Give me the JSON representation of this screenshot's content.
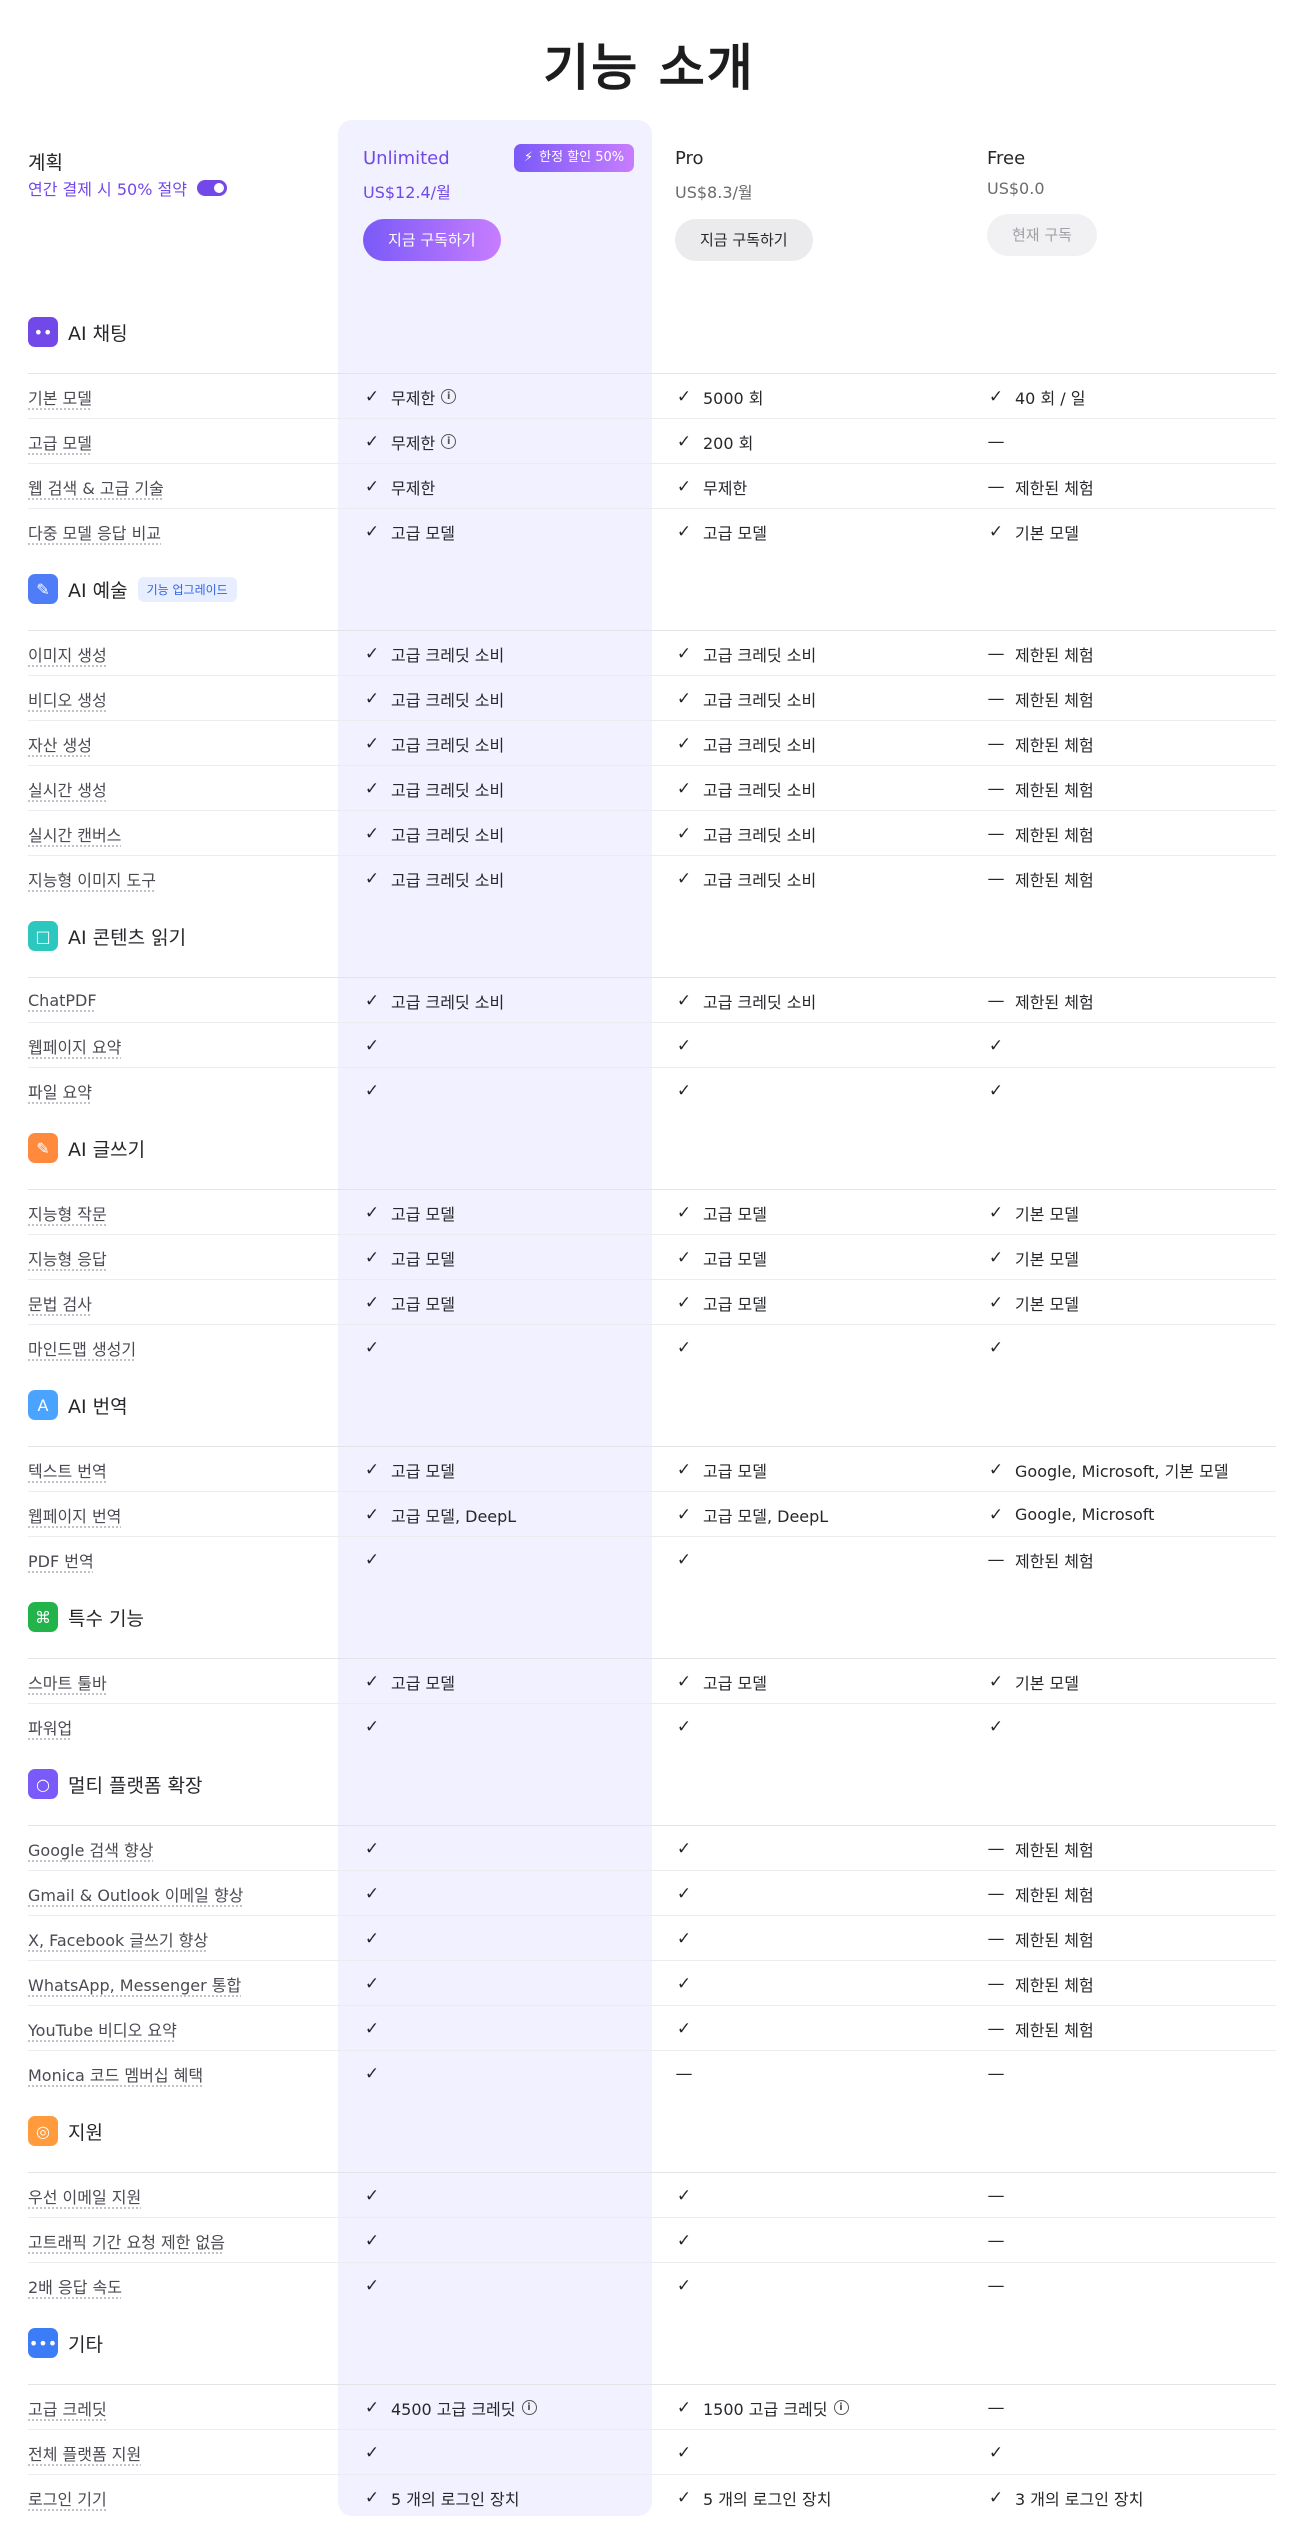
{
  "title": "기능 소개",
  "header": {
    "plan_label": "계획",
    "annual_text": "연간 결제 시 50% 절약",
    "badge": "한정 할인 50%",
    "plans": [
      {
        "name": "Unlimited",
        "price": "US$12.4/월",
        "button": "지금 구독하기"
      },
      {
        "name": "Pro",
        "price": "US$8.3/월",
        "button": "지금 구독하기"
      },
      {
        "name": "Free",
        "price": "US$0.0",
        "button": "현재 구독"
      }
    ]
  },
  "sections": [
    {
      "title": "AI 채팅",
      "icon": "chat-bubble-icon",
      "color": "#7248e8",
      "rows": [
        {
          "label": "기본 모델",
          "cells": [
            [
              "check",
              "무제한",
              true
            ],
            [
              "check",
              "5000 회"
            ],
            [
              "check",
              "40 회 / 일"
            ]
          ]
        },
        {
          "label": "고급 모델",
          "cells": [
            [
              "check",
              "무제한",
              true
            ],
            [
              "check",
              "200 회"
            ],
            [
              "dash",
              ""
            ]
          ]
        },
        {
          "label": "웹 검색 & 고급 기술",
          "cells": [
            [
              "check",
              "무제한"
            ],
            [
              "check",
              "무제한"
            ],
            [
              "dash",
              "제한된 체험"
            ]
          ]
        },
        {
          "label": "다중 모델 응답 비교",
          "cells": [
            [
              "check",
              "고급 모델"
            ],
            [
              "check",
              "고급 모델"
            ],
            [
              "check",
              "기본 모델"
            ]
          ]
        }
      ]
    },
    {
      "title": "AI 예술",
      "tag": "기능 업그레이드",
      "icon": "brush-icon",
      "color": "#4f7cf7",
      "rows": [
        {
          "label": "이미지 생성",
          "cells": [
            [
              "check",
              "고급 크레딧 소비"
            ],
            [
              "check",
              "고급 크레딧 소비"
            ],
            [
              "dash",
              "제한된 체험"
            ]
          ]
        },
        {
          "label": "비디오 생성",
          "cells": [
            [
              "check",
              "고급 크레딧 소비"
            ],
            [
              "check",
              "고급 크레딧 소비"
            ],
            [
              "dash",
              "제한된 체험"
            ]
          ]
        },
        {
          "label": "자산 생성",
          "cells": [
            [
              "check",
              "고급 크레딧 소비"
            ],
            [
              "check",
              "고급 크레딧 소비"
            ],
            [
              "dash",
              "제한된 체험"
            ]
          ]
        },
        {
          "label": "실시간 생성",
          "cells": [
            [
              "check",
              "고급 크레딧 소비"
            ],
            [
              "check",
              "고급 크레딧 소비"
            ],
            [
              "dash",
              "제한된 체험"
            ]
          ]
        },
        {
          "label": "실시간 캔버스",
          "cells": [
            [
              "check",
              "고급 크레딧 소비"
            ],
            [
              "check",
              "고급 크레딧 소비"
            ],
            [
              "dash",
              "제한된 체험"
            ]
          ]
        },
        {
          "label": "지능형 이미지 도구",
          "cells": [
            [
              "check",
              "고급 크레딧 소비"
            ],
            [
              "check",
              "고급 크레딧 소비"
            ],
            [
              "dash",
              "제한된 체험"
            ]
          ]
        }
      ]
    },
    {
      "title": "AI 콘텐츠 읽기",
      "icon": "book-icon",
      "color": "#2cc8c0",
      "rows": [
        {
          "label": "ChatPDF",
          "cells": [
            [
              "check",
              "고급 크레딧 소비"
            ],
            [
              "check",
              "고급 크레딧 소비"
            ],
            [
              "dash",
              "제한된 체험"
            ]
          ]
        },
        {
          "label": "웹페이지 요약",
          "cells": [
            [
              "check",
              ""
            ],
            [
              "check",
              ""
            ],
            [
              "check",
              ""
            ]
          ]
        },
        {
          "label": "파일 요약",
          "cells": [
            [
              "check",
              ""
            ],
            [
              "check",
              ""
            ],
            [
              "check",
              ""
            ]
          ]
        }
      ]
    },
    {
      "title": "AI 글쓰기",
      "icon": "pencil-icon",
      "color": "#ff8a3d",
      "rows": [
        {
          "label": "지능형 작문",
          "cells": [
            [
              "check",
              "고급 모델"
            ],
            [
              "check",
              "고급 모델"
            ],
            [
              "check",
              "기본 모델"
            ]
          ]
        },
        {
          "label": "지능형 응답",
          "cells": [
            [
              "check",
              "고급 모델"
            ],
            [
              "check",
              "고급 모델"
            ],
            [
              "check",
              "기본 모델"
            ]
          ]
        },
        {
          "label": "문법 검사",
          "cells": [
            [
              "check",
              "고급 모델"
            ],
            [
              "check",
              "고급 모델"
            ],
            [
              "check",
              "기본 모델"
            ]
          ]
        },
        {
          "label": "마인드맵 생성기",
          "cells": [
            [
              "check",
              ""
            ],
            [
              "check",
              ""
            ],
            [
              "check",
              ""
            ]
          ]
        }
      ]
    },
    {
      "title": "AI 번역",
      "icon": "translate-icon",
      "color": "#4aa3ff",
      "rows": [
        {
          "label": "텍스트 번역",
          "cells": [
            [
              "check",
              "고급 모델"
            ],
            [
              "check",
              "고급 모델"
            ],
            [
              "check",
              "Google, Microsoft, 기본 모델"
            ]
          ]
        },
        {
          "label": "웹페이지 번역",
          "cells": [
            [
              "check",
              "고급 모델, DeepL"
            ],
            [
              "check",
              "고급 모델, DeepL"
            ],
            [
              "check",
              "Google, Microsoft"
            ]
          ]
        },
        {
          "label": "PDF 번역",
          "cells": [
            [
              "check",
              ""
            ],
            [
              "check",
              ""
            ],
            [
              "dash",
              "제한된 체험"
            ]
          ]
        }
      ]
    },
    {
      "title": "특수 기능",
      "icon": "command-icon",
      "color": "#22b44a",
      "rows": [
        {
          "label": "스마트 툴바",
          "cells": [
            [
              "check",
              "고급 모델"
            ],
            [
              "check",
              "고급 모델"
            ],
            [
              "check",
              "기본 모델"
            ]
          ]
        },
        {
          "label": "파워업",
          "cells": [
            [
              "check",
              ""
            ],
            [
              "check",
              ""
            ],
            [
              "check",
              ""
            ]
          ]
        }
      ]
    },
    {
      "title": "멀티 플랫폼 확장",
      "icon": "planet-icon",
      "color": "#7a5af8",
      "rows": [
        {
          "label": "Google 검색 향상",
          "cells": [
            [
              "check",
              ""
            ],
            [
              "check",
              ""
            ],
            [
              "dash",
              "제한된 체험"
            ]
          ]
        },
        {
          "label": "Gmail & Outlook 이메일 향상",
          "cells": [
            [
              "check",
              ""
            ],
            [
              "check",
              ""
            ],
            [
              "dash",
              "제한된 체험"
            ]
          ]
        },
        {
          "label": "X, Facebook 글쓰기 향상",
          "cells": [
            [
              "check",
              ""
            ],
            [
              "check",
              ""
            ],
            [
              "dash",
              "제한된 체험"
            ]
          ]
        },
        {
          "label": "WhatsApp, Messenger 통합",
          "cells": [
            [
              "check",
              ""
            ],
            [
              "check",
              ""
            ],
            [
              "dash",
              "제한된 체험"
            ]
          ]
        },
        {
          "label": "YouTube 비디오 요약",
          "cells": [
            [
              "check",
              ""
            ],
            [
              "check",
              ""
            ],
            [
              "dash",
              "제한된 체험"
            ]
          ]
        },
        {
          "label": "Monica 코드 멤버십 혜택",
          "cells": [
            [
              "check",
              ""
            ],
            [
              "dash",
              ""
            ],
            [
              "dash",
              ""
            ]
          ]
        }
      ]
    },
    {
      "title": "지원",
      "icon": "support-icon",
      "color": "#ff9a3d",
      "rows": [
        {
          "label": "우선 이메일 지원",
          "cells": [
            [
              "check",
              ""
            ],
            [
              "check",
              ""
            ],
            [
              "dash",
              ""
            ]
          ]
        },
        {
          "label": "고트래픽 기간 요청 제한 없음",
          "cells": [
            [
              "check",
              ""
            ],
            [
              "check",
              ""
            ],
            [
              "dash",
              ""
            ]
          ]
        },
        {
          "label": "2배 응답 속도",
          "cells": [
            [
              "check",
              ""
            ],
            [
              "check",
              ""
            ],
            [
              "dash",
              ""
            ]
          ]
        }
      ]
    },
    {
      "title": "기타",
      "icon": "more-icon",
      "color": "#3d7cf7",
      "rows": [
        {
          "label": "고급 크레딧",
          "cells": [
            [
              "check",
              "4500 고급 크레딧",
              true
            ],
            [
              "check",
              "1500 고급 크레딧",
              true
            ],
            [
              "dash",
              ""
            ]
          ]
        },
        {
          "label": "전체 플랫폼 지원",
          "cells": [
            [
              "check",
              ""
            ],
            [
              "check",
              ""
            ],
            [
              "check",
              ""
            ]
          ]
        },
        {
          "label": "로그인 기기",
          "cells": [
            [
              "check",
              "5 개의 로그인 장치"
            ],
            [
              "check",
              "5 개의 로그인 장치"
            ],
            [
              "check",
              "3 개의 로그인 장치"
            ]
          ]
        }
      ]
    }
  ]
}
